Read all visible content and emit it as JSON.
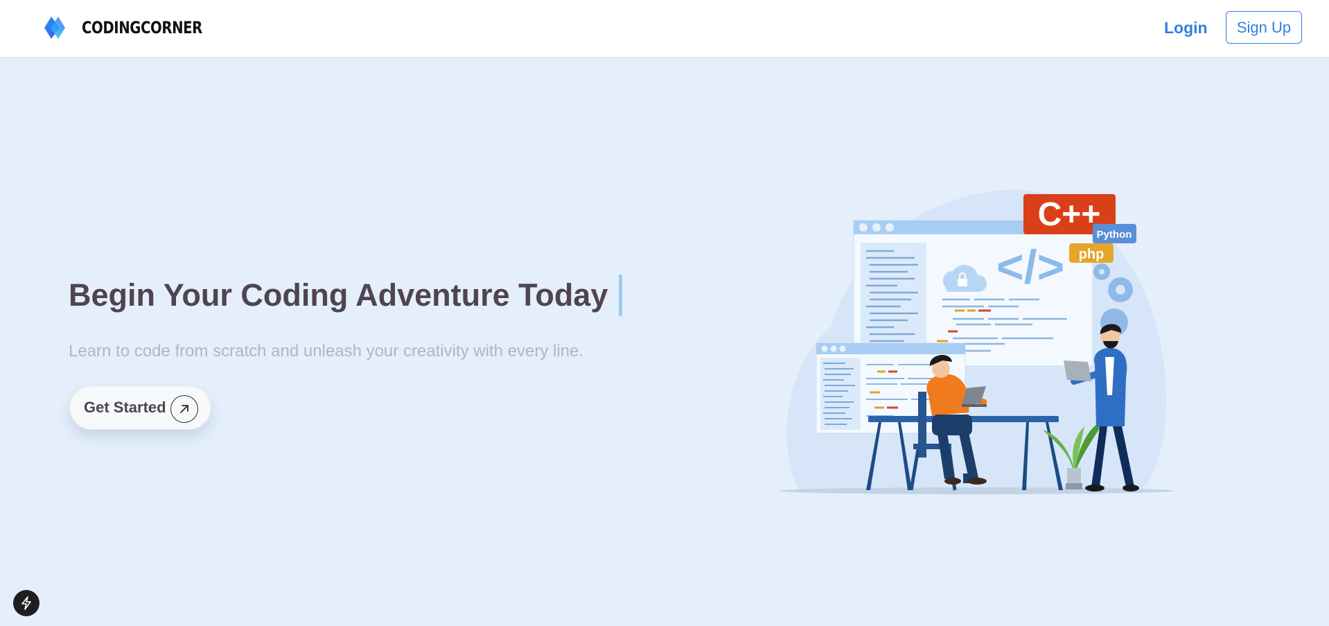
{
  "brand": {
    "name": "CODINGCORNER",
    "logo_icon": "diamond-logo-icon"
  },
  "nav": {
    "login_label": "Login",
    "signup_label": "Sign Up"
  },
  "hero": {
    "title": "Begin Your Coding Adventure Today",
    "subtitle": "Learn to code from scratch and unleash your creativity with every line.",
    "cta_label": "Get Started",
    "cta_icon": "arrow-up-right-icon"
  },
  "illustration": {
    "badges": {
      "cpp": "C++",
      "python": "Python",
      "php": "php"
    },
    "code_symbol": "</>"
  },
  "colors": {
    "accent": "#2f7fe0",
    "background": "#e4effb",
    "title": "#4f4450",
    "subtitle": "#b3b6bb"
  },
  "widgets": {
    "bolt_icon": "lightning-bolt-icon"
  }
}
